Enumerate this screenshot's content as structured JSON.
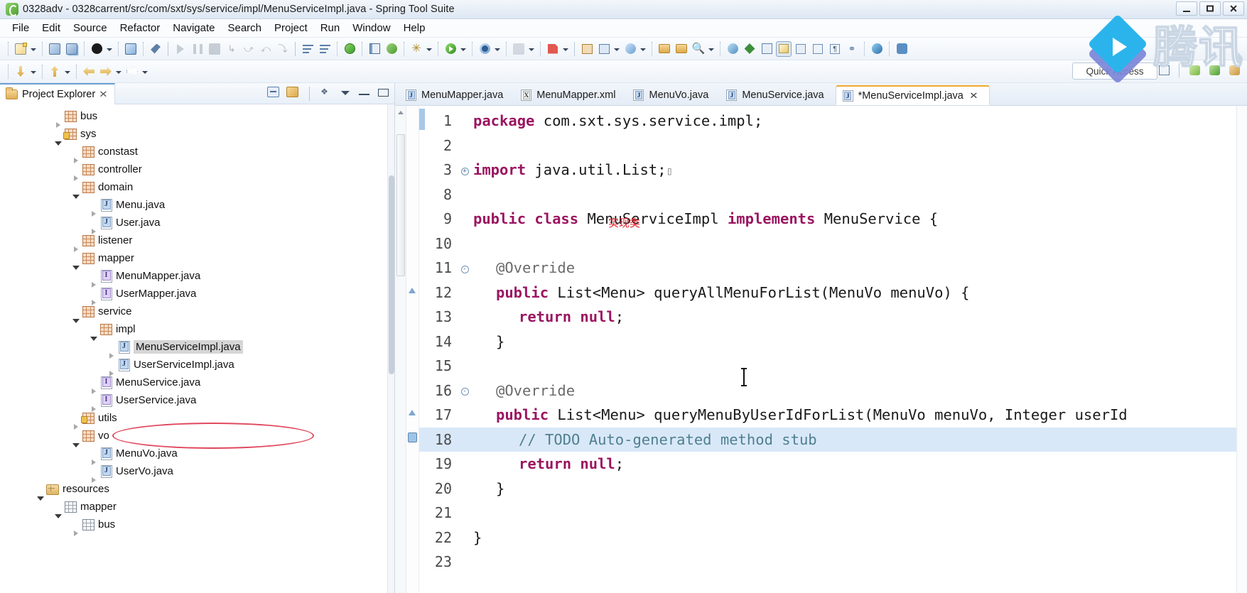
{
  "window": {
    "title": "0328adv - 0328carrent/src/com/sxt/sys/service/impl/MenuServiceImpl.java - Spring Tool Suite",
    "app_icon": "spring-leaf-icon",
    "minimize": "minimize-button",
    "maximize": "maximize-button",
    "close": "close-button"
  },
  "menubar": [
    {
      "label": "File"
    },
    {
      "label": "Edit"
    },
    {
      "label": "Source"
    },
    {
      "label": "Refactor"
    },
    {
      "label": "Navigate"
    },
    {
      "label": "Search"
    },
    {
      "label": "Project"
    },
    {
      "label": "Run"
    },
    {
      "label": "Window"
    },
    {
      "label": "Help"
    }
  ],
  "toolbar": {
    "quick_access": "Quick Access",
    "row1_icons": [
      "new-wizard-icon",
      "new-dropdown-arrow",
      "save-icon",
      "save-all-icon",
      "java-perspective-icon",
      "person-dropdown-arrow",
      "open-type-icon",
      "link-editor-icon",
      "run-last-tool-icon",
      "pause-icon",
      "stop-icon",
      "step-into-icon",
      "step-over-icon",
      "step-return-icon",
      "drop-to-frame-icon",
      "next-annotation-icon",
      "previous-annotation-icon",
      "debug-icon",
      "run-icon",
      "run-dropdown-arrow",
      "external-tools-icon",
      "external-dropdown-arrow",
      "coverage-icon",
      "coverage-dropdown-arrow",
      "build-icon",
      "build-dropdown-arrow",
      "new-java-project-icon",
      "new-package-icon",
      "new-package-dropdown-arrow",
      "new-class-icon",
      "new-class-dropdown-arrow",
      "open-file-icon",
      "open-folder-icon",
      "search-icon",
      "search-dropdown-arrow",
      "globe-icon",
      "spring-icon",
      "edit-icon",
      "console-icon",
      "properties-icon",
      "outline-icon",
      "pilcrow-icon",
      "team-icon",
      "web-icon",
      "user-add-icon"
    ],
    "row2_icons": [
      "back-down-icon",
      "back-down-arrow",
      "forward-up-icon",
      "forward-up-arrow",
      "back-nav-icon",
      "forward-nav-icon",
      "forward-nav-arrow",
      "next-edit-icon",
      "next-edit-arrow"
    ],
    "perspective_icons": [
      "open-perspective-icon",
      "java-ee-perspective-icon",
      "spring-perspective-icon",
      "java-perspective-icon"
    ]
  },
  "explorer": {
    "tab_label": "Project Explorer",
    "tab_icon": "project-folder-icon",
    "close_icon": "close-icon",
    "tools": [
      "collapse-all-icon",
      "link-with-editor-icon",
      "focus-on-active-task-icon",
      "view-menu-icon",
      "minimize-icon",
      "maximize-icon"
    ],
    "tree": [
      {
        "label": "bus",
        "indent": 3,
        "twisty": "collapsed",
        "icon": "package-icon",
        "selected": false
      },
      {
        "label": "sys",
        "indent": 3,
        "twisty": "expanded",
        "icon": "package-locked-icon",
        "selected": false
      },
      {
        "label": "constast",
        "indent": 4,
        "twisty": "collapsed",
        "icon": "package-icon",
        "selected": false
      },
      {
        "label": "controller",
        "indent": 4,
        "twisty": "collapsed",
        "icon": "package-icon",
        "selected": false
      },
      {
        "label": "domain",
        "indent": 4,
        "twisty": "expanded",
        "icon": "package-icon",
        "selected": false
      },
      {
        "label": "Menu.java",
        "indent": 5,
        "twisty": "collapsed",
        "icon": "java-class-icon",
        "selected": false
      },
      {
        "label": "User.java",
        "indent": 5,
        "twisty": "collapsed",
        "icon": "java-class-icon",
        "selected": false
      },
      {
        "label": "listener",
        "indent": 4,
        "twisty": "collapsed",
        "icon": "package-icon",
        "selected": false
      },
      {
        "label": "mapper",
        "indent": 4,
        "twisty": "expanded",
        "icon": "package-icon",
        "selected": false
      },
      {
        "label": "MenuMapper.java",
        "indent": 5,
        "twisty": "collapsed",
        "icon": "java-interface-icon",
        "selected": false
      },
      {
        "label": "UserMapper.java",
        "indent": 5,
        "twisty": "collapsed",
        "icon": "java-interface-icon",
        "selected": false
      },
      {
        "label": "service",
        "indent": 4,
        "twisty": "expanded",
        "icon": "package-icon",
        "selected": false
      },
      {
        "label": "impl",
        "indent": 5,
        "twisty": "expanded",
        "icon": "package-icon",
        "selected": false
      },
      {
        "label": "MenuServiceImpl.java",
        "indent": 6,
        "twisty": "collapsed",
        "icon": "java-class-icon",
        "selected": true
      },
      {
        "label": "UserServiceImpl.java",
        "indent": 6,
        "twisty": "collapsed",
        "icon": "java-class-icon",
        "selected": false
      },
      {
        "label": "MenuService.java",
        "indent": 5,
        "twisty": "collapsed",
        "icon": "java-interface-icon",
        "selected": false
      },
      {
        "label": "UserService.java",
        "indent": 5,
        "twisty": "collapsed",
        "icon": "java-interface-icon",
        "selected": false
      },
      {
        "label": "utils",
        "indent": 4,
        "twisty": "collapsed",
        "icon": "package-locked-icon",
        "selected": false
      },
      {
        "label": "vo",
        "indent": 4,
        "twisty": "expanded",
        "icon": "package-icon",
        "selected": false
      },
      {
        "label": "MenuVo.java",
        "indent": 5,
        "twisty": "collapsed",
        "icon": "java-class-icon",
        "selected": false
      },
      {
        "label": "UserVo.java",
        "indent": 5,
        "twisty": "collapsed",
        "icon": "java-class-icon",
        "selected": false
      },
      {
        "label": "resources",
        "indent": 2,
        "twisty": "expanded",
        "icon": "source-folder-icon",
        "selected": false
      },
      {
        "label": "mapper",
        "indent": 3,
        "twisty": "expanded",
        "icon": "package-gray-icon",
        "selected": false
      },
      {
        "label": "bus",
        "indent": 4,
        "twisty": "collapsed",
        "icon": "package-gray-icon",
        "selected": false
      }
    ],
    "annotation": {
      "shape": "red-ellipse",
      "target": "MenuServiceImpl.java"
    }
  },
  "editor": {
    "tabs": [
      {
        "label": "MenuMapper.java",
        "icon": "java-file-icon",
        "active": false,
        "dirty": false
      },
      {
        "label": "MenuMapper.xml",
        "icon": "xml-file-icon",
        "active": false,
        "dirty": false
      },
      {
        "label": "MenuVo.java",
        "icon": "java-file-icon",
        "active": false,
        "dirty": false
      },
      {
        "label": "MenuService.java",
        "icon": "java-file-icon",
        "active": false,
        "dirty": false
      },
      {
        "label": "*MenuServiceImpl.java",
        "icon": "java-file-icon",
        "active": true,
        "dirty": true
      }
    ],
    "close_icon": "close-icon",
    "annotation_text": "实现类",
    "annotation_color": "#e0202a",
    "current_line": 18,
    "code_lines": [
      {
        "num": "1",
        "fold": "",
        "indent": 0,
        "tokens": [
          {
            "t": "package",
            "c": "kw"
          },
          {
            "t": " com.sxt.sys.service.impl;",
            "c": "plain"
          }
        ]
      },
      {
        "num": "2",
        "fold": "",
        "indent": 0,
        "tokens": []
      },
      {
        "num": "3",
        "fold": "+",
        "indent": 0,
        "tokens": [
          {
            "t": "import",
            "c": "kw"
          },
          {
            "t": " java.util.List;",
            "c": "plain"
          },
          {
            "t": "▯",
            "c": "fold"
          }
        ]
      },
      {
        "num": "8",
        "fold": "",
        "indent": 0,
        "tokens": []
      },
      {
        "num": "9",
        "fold": "",
        "indent": 0,
        "tokens": [
          {
            "t": "public class",
            "c": "kw"
          },
          {
            "t": " MenuServiceImpl ",
            "c": "plain"
          },
          {
            "t": "implements",
            "c": "kw"
          },
          {
            "t": " MenuService {",
            "c": "plain"
          }
        ]
      },
      {
        "num": "10",
        "fold": "",
        "indent": 0,
        "tokens": []
      },
      {
        "num": "11",
        "fold": "-",
        "indent": 1,
        "tokens": [
          {
            "t": "@Override",
            "c": "ann"
          }
        ]
      },
      {
        "num": "12",
        "fold": "",
        "indent": 1,
        "warn": true,
        "tokens": [
          {
            "t": "public",
            "c": "kw"
          },
          {
            "t": " List<Menu> queryAllMenuForList(MenuVo menuVo) {",
            "c": "plain"
          }
        ]
      },
      {
        "num": "13",
        "fold": "",
        "indent": 2,
        "tokens": [
          {
            "t": "return null",
            "c": "kw"
          },
          {
            "t": ";",
            "c": "plain"
          }
        ]
      },
      {
        "num": "14",
        "fold": "",
        "indent": 1,
        "tokens": [
          {
            "t": "}",
            "c": "plain"
          }
        ]
      },
      {
        "num": "15",
        "fold": "",
        "indent": 0,
        "tokens": []
      },
      {
        "num": "16",
        "fold": "-",
        "indent": 1,
        "tokens": [
          {
            "t": "@Override",
            "c": "ann"
          }
        ]
      },
      {
        "num": "17",
        "fold": "",
        "indent": 1,
        "warn": true,
        "tokens": [
          {
            "t": "public",
            "c": "kw"
          },
          {
            "t": " List<Menu> queryMenuByUserIdForList(MenuVo menuVo, Integer userId",
            "c": "plain"
          }
        ]
      },
      {
        "num": "18",
        "fold": "",
        "indent": 2,
        "todo": true,
        "current": true,
        "tokens": [
          {
            "t": "// TODO Auto-generated method stub",
            "c": "cmt"
          }
        ]
      },
      {
        "num": "19",
        "fold": "",
        "indent": 2,
        "tokens": [
          {
            "t": "return null",
            "c": "kw"
          },
          {
            "t": ";",
            "c": "plain"
          }
        ]
      },
      {
        "num": "20",
        "fold": "",
        "indent": 1,
        "tokens": [
          {
            "t": "}",
            "c": "plain"
          }
        ]
      },
      {
        "num": "21",
        "fold": "",
        "indent": 0,
        "tokens": []
      },
      {
        "num": "22",
        "fold": "",
        "indent": 0,
        "tokens": [
          {
            "t": "}",
            "c": "plain"
          }
        ]
      },
      {
        "num": "23",
        "fold": "",
        "indent": 0,
        "tokens": []
      }
    ]
  },
  "watermark": {
    "text": "腾讯",
    "logo": "play-diamond-icon"
  },
  "colors": {
    "keyword": "#9b1560",
    "comment": "#4f7f8f",
    "annotation_gray": "#6a6a6a",
    "current_line": "#d9e8f8",
    "red_accent": "#e0202a",
    "ellipse": "#e0485e"
  }
}
